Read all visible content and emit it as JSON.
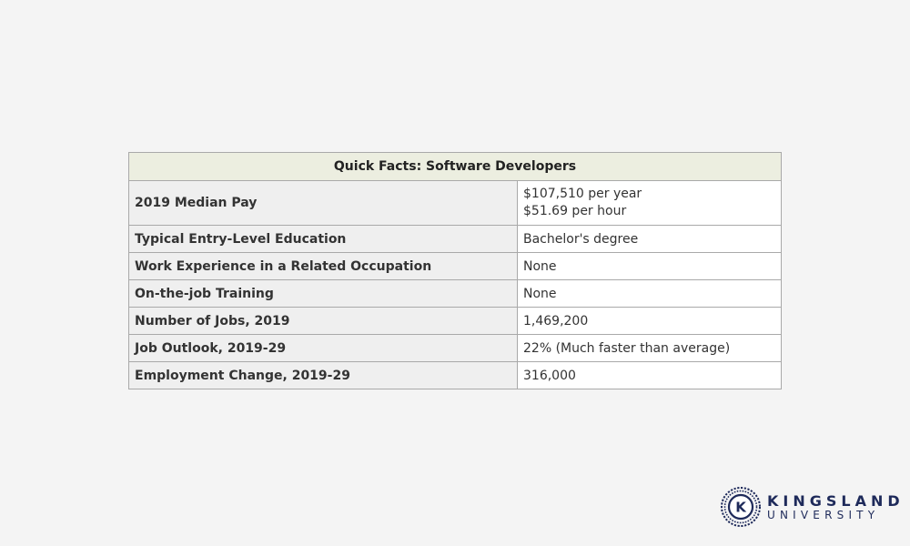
{
  "table": {
    "caption": "Quick Facts: Software Developers",
    "rows": [
      {
        "label": "2019 Median Pay",
        "values": [
          "$107,510 per year",
          "$51.69 per hour"
        ]
      },
      {
        "label": "Typical Entry-Level Education",
        "values": [
          "Bachelor's degree"
        ]
      },
      {
        "label": "Work Experience in a Related Occupation",
        "values": [
          "None"
        ]
      },
      {
        "label": "On-the-job Training",
        "values": [
          "None"
        ]
      },
      {
        "label": "Number of Jobs, 2019",
        "values": [
          "1,469,200"
        ]
      },
      {
        "label": "Job Outlook, 2019-29",
        "values": [
          "22% (Much faster than average)"
        ]
      },
      {
        "label": "Employment Change, 2019-29",
        "values": [
          "316,000"
        ]
      }
    ]
  },
  "logo": {
    "mark_letter": "K",
    "name_top": "KINGSLAND",
    "name_bottom": "UNIVERSITY",
    "color": "#1e2a5a"
  },
  "colors": {
    "background": "#f4f4f4",
    "header_fill": "#eceee0",
    "label_fill": "#efefef",
    "border": "#a9a9a9"
  }
}
